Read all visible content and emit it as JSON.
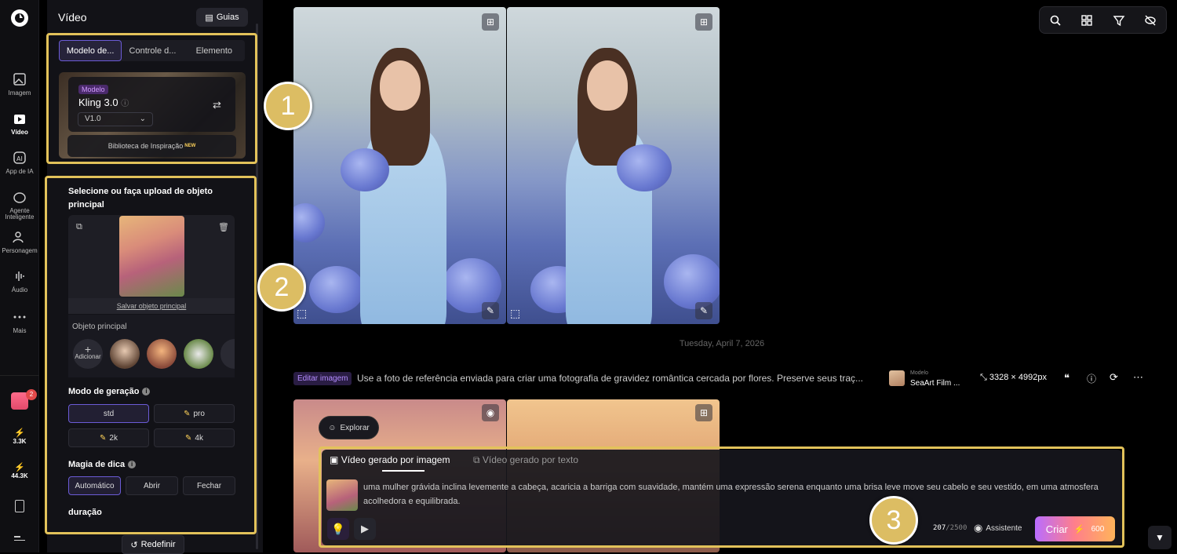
{
  "rail": {
    "items": [
      {
        "label": "Imagem",
        "icon": "image-icon"
      },
      {
        "label": "Vídeo",
        "icon": "video-icon"
      },
      {
        "label": "App de IA",
        "icon": "ai-app-icon"
      },
      {
        "label": "Agente Inteligente",
        "icon": "agent-icon"
      },
      {
        "label": "Personagem",
        "icon": "character-icon"
      },
      {
        "label": "Áudio",
        "icon": "audio-icon"
      },
      {
        "label": "Mais",
        "icon": "more-icon"
      }
    ],
    "gift_badge": "2",
    "credits_a": "3.3K",
    "credits_b": "44.3K"
  },
  "panel": {
    "title": "Vídeo",
    "guias_label": "Guias",
    "tabs": [
      "Modelo de...",
      "Controle d...",
      "Elemento"
    ],
    "model_badge": "Modelo",
    "model_name": "Kling 3.0",
    "model_version": "V1.0",
    "inspiration": "Biblioteca de Inspiração",
    "inspiration_new": "NEW",
    "upload_title": "Selecione ou faça upload de objeto principal",
    "save_object": "Salvar objeto principal",
    "object_label": "Objeto principal",
    "add_label": "Adicionar",
    "mode_title": "Modo de geração",
    "mode_options": [
      "std",
      "pro",
      "2k",
      "4k"
    ],
    "magic_title": "Magia de dica",
    "magic_options": [
      "Automático",
      "Abrir",
      "Fechar"
    ],
    "duration_title": "duração",
    "reset_label": "Redefinir"
  },
  "feed": {
    "date": "Tuesday, April 7, 2026",
    "edit_badge": "Editar imagem",
    "prompt": "Use a foto de referência enviada para criar uma fotografia de gravidez romântica cercada por flores. Preserve seus traç...",
    "model_caption": "Modelo",
    "model_value": "SeaArt Film ...",
    "resolution": "3328 × 4992px",
    "explore_label": "Explorar"
  },
  "composer": {
    "tab_image": "Vídeo gerado por imagem",
    "tab_text": "Vídeo gerado por texto",
    "prompt_text": "uma mulher grávida inclina levemente a cabeça, acaricia a barriga com suavidade, mantém uma expressão serena enquanto uma brisa leve move seu cabelo e seu vestido, em uma atmosfera acolhedora e equilibrada.",
    "char_count": "207",
    "char_max": "/2500",
    "assistant_label": "Assistente",
    "create_label": "Criar",
    "create_cost": "600"
  },
  "callouts": [
    "1",
    "2",
    "3"
  ],
  "colors": {
    "highlight": "#e2c25a",
    "accent": "#6b5bd6",
    "callout": "#dcbd63"
  }
}
